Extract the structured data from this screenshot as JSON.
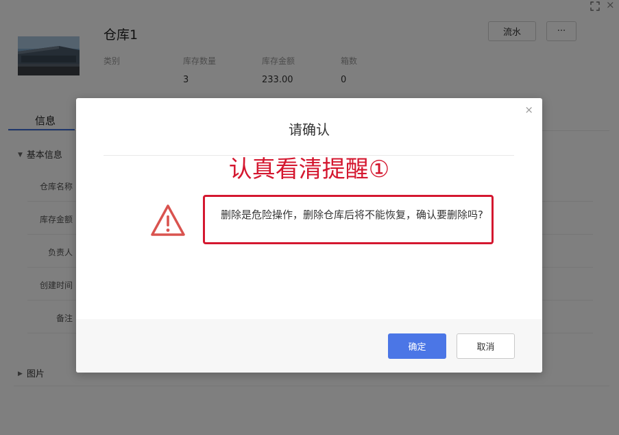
{
  "header": {
    "title": "仓库1",
    "stats": [
      {
        "label": "类别",
        "value": ""
      },
      {
        "label": "库存数量",
        "value": "3"
      },
      {
        "label": "库存金额",
        "value": "233.00"
      },
      {
        "label": "箱数",
        "value": "0"
      }
    ],
    "buttons": {
      "flow": "流水",
      "more": "···"
    }
  },
  "tabs": {
    "info": "信息"
  },
  "sections": {
    "basic": "基本信息",
    "images": "图片"
  },
  "fields": [
    "仓库名称",
    "库存金额",
    "负责人",
    "创建时间",
    "备注"
  ],
  "dialog": {
    "title": "请确认",
    "annotation": "认真看清提醒①",
    "message": "删除是危险操作，删除仓库后将不能恢复，确认要删除吗?",
    "ok_label": "确定",
    "cancel_label": "取消",
    "close_glyph": "×"
  },
  "icons": {
    "warning": "warning-triangle-icon",
    "fullscreen": "fullscreen-icon",
    "close": "close-icon",
    "caret": "caret-icon"
  },
  "colors": {
    "primary": "#4b76e6",
    "annotation_red": "#d4172f",
    "warning_red": "#d9534f",
    "tab_underline": "#3f6ed8"
  }
}
